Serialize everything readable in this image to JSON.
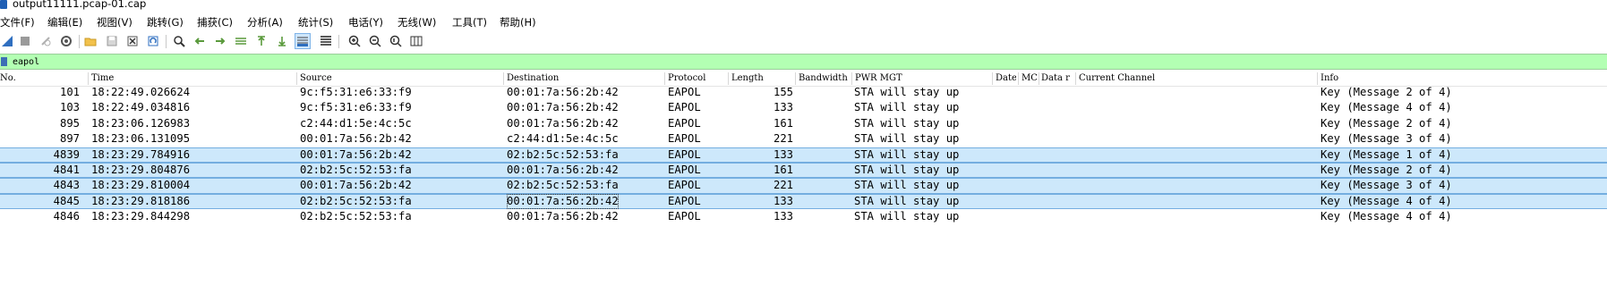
{
  "window": {
    "title": "output11111.pcap-01.cap"
  },
  "menu": [
    "文件(F)",
    "编辑(E)",
    "视图(V)",
    "跳转(G)",
    "捕获(C)",
    "分析(A)",
    "统计(S)",
    "电话(Y)",
    "无线(W)",
    "工具(T)",
    "帮助(H)"
  ],
  "toolbar": {
    "icons": [
      "shark-fin-start-icon",
      "stop-capture-icon",
      "restart-capture-icon",
      "capture-options-icon",
      "open-file-icon",
      "save-file-icon",
      "close-file-icon",
      "reload-file-icon",
      "find-packet-icon",
      "go-back-icon",
      "go-forward-icon",
      "go-to-packet-icon",
      "go-first-icon",
      "go-last-icon",
      "auto-scroll-icon",
      "colorize-icon",
      "zoom-in-icon",
      "zoom-out-icon",
      "normal-size-icon",
      "resize-columns-icon"
    ]
  },
  "filter": {
    "value": "eapol"
  },
  "columns": [
    "No.",
    "Time",
    "Source",
    "Destination",
    "Protocol",
    "Length",
    "Bandwidth",
    "PWR MGT",
    "Date",
    "MC",
    "Data r",
    "Current Channel",
    "Info"
  ],
  "packets": [
    {
      "no": "101",
      "time": "18:22:49.026624",
      "source": "9c:f5:31:e6:33:f9",
      "destination": "00:01:7a:56:2b:42",
      "protocol": "EAPOL",
      "length": "155",
      "pwr": "STA will stay up",
      "info": "Key (Message 2 of 4)",
      "highlight": false
    },
    {
      "no": "103",
      "time": "18:22:49.034816",
      "source": "9c:f5:31:e6:33:f9",
      "destination": "00:01:7a:56:2b:42",
      "protocol": "EAPOL",
      "length": "133",
      "pwr": "STA will stay up",
      "info": "Key (Message 4 of 4)",
      "highlight": false
    },
    {
      "no": "895",
      "time": "18:23:06.126983",
      "source": "c2:44:d1:5e:4c:5c",
      "destination": "00:01:7a:56:2b:42",
      "protocol": "EAPOL",
      "length": "161",
      "pwr": "STA will stay up",
      "info": "Key (Message 2 of 4)",
      "highlight": false
    },
    {
      "no": "897",
      "time": "18:23:06.131095",
      "source": "00:01:7a:56:2b:42",
      "destination": "c2:44:d1:5e:4c:5c",
      "protocol": "EAPOL",
      "length": "221",
      "pwr": "STA will stay up",
      "info": "Key (Message 3 of 4)",
      "highlight": false
    },
    {
      "no": "4839",
      "time": "18:23:29.784916",
      "source": "00:01:7a:56:2b:42",
      "destination": "02:b2:5c:52:53:fa",
      "protocol": "EAPOL",
      "length": "133",
      "pwr": "STA will stay up",
      "info": "Key (Message 1 of 4)",
      "highlight": true
    },
    {
      "no": "4841",
      "time": "18:23:29.804876",
      "source": "02:b2:5c:52:53:fa",
      "destination": "00:01:7a:56:2b:42",
      "protocol": "EAPOL",
      "length": "161",
      "pwr": "STA will stay up",
      "info": "Key (Message 2 of 4)",
      "highlight": true
    },
    {
      "no": "4843",
      "time": "18:23:29.810004",
      "source": "00:01:7a:56:2b:42",
      "destination": "02:b2:5c:52:53:fa",
      "protocol": "EAPOL",
      "length": "221",
      "pwr": "STA will stay up",
      "info": "Key (Message 3 of 4)",
      "highlight": true
    },
    {
      "no": "4845",
      "time": "18:23:29.818186",
      "source": "02:b2:5c:52:53:fa",
      "destination": "00:01:7a:56:2b:42",
      "protocol": "EAPOL",
      "length": "133",
      "pwr": "STA will stay up",
      "info": "Key (Message 4 of 4)",
      "highlight": true
    },
    {
      "no": "4846",
      "time": "18:23:29.844298",
      "source": "02:b2:5c:52:53:fa",
      "destination": "00:01:7a:56:2b:42",
      "protocol": "EAPOL",
      "length": "133",
      "pwr": "STA will stay up",
      "info": "Key (Message 4 of 4)",
      "highlight": false
    }
  ],
  "colors": {
    "filter_ok": "#b3ffb3",
    "row_highlight": "#cde8fb",
    "row_border": "#74aee0"
  }
}
